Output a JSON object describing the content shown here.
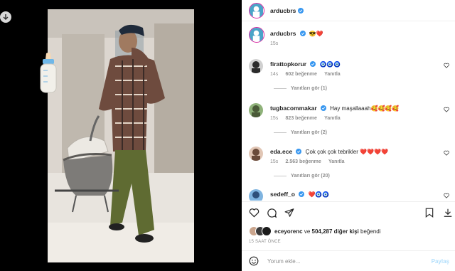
{
  "post": {
    "author": "arducbrs",
    "caption_emojis": "😎❤️",
    "time": "15s"
  },
  "comments": [
    {
      "user": "firattopkorur",
      "text": "🧿🧿🧿",
      "time": "14s",
      "likes": "602 beğenme",
      "reply": "Yanıtla",
      "view_replies": "Yanıtları gör (1)"
    },
    {
      "user": "tugbacommakar",
      "text": "Hay maşallaaah🥰🥰🥰🥰",
      "time": "15s",
      "likes": "823 beğenme",
      "reply": "Yanıtla",
      "view_replies": "Yanıtları gör (2)"
    },
    {
      "user": "eda.ece",
      "text": "Çok çok çok tebrikler ❤️❤️❤️❤️",
      "time": "15s",
      "likes": "2.563 beğenme",
      "reply": "Yanıtla",
      "view_replies": "Yanıtları gör (20)"
    },
    {
      "user": "sedeff_o",
      "text": "❤️🧿🧿"
    }
  ],
  "likes": {
    "first_user": "eceyorenc",
    "connector": "ve",
    "others": "504,287 diğer kişi",
    "suffix": "beğendi"
  },
  "timestamp": "15 SAAT ÖNCE",
  "comment_input": {
    "placeholder": "Yorum ekle...",
    "post_label": "Paylaş"
  },
  "colors": {
    "verified": "#3897f0",
    "link_disabled": "#b2dffc",
    "muted": "#8e8e8e"
  }
}
